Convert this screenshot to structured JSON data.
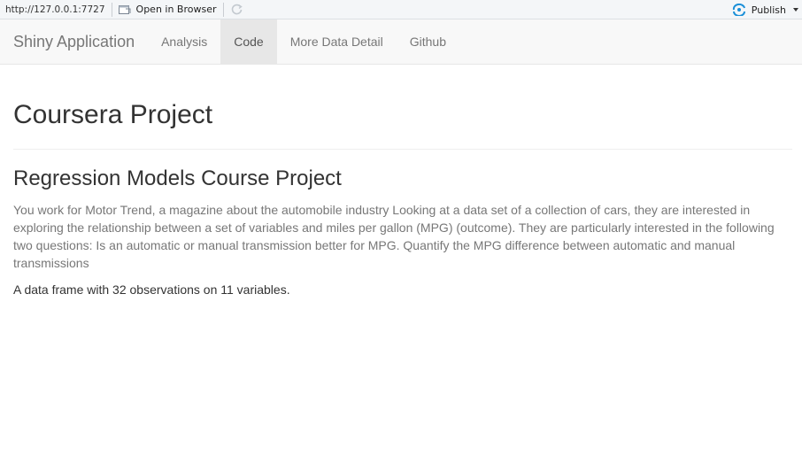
{
  "viewer": {
    "url": "http://127.0.0.1:7727",
    "open_browser_label": "Open in Browser",
    "publish_label": "Publish"
  },
  "navbar": {
    "brand": "Shiny Application",
    "tabs": [
      {
        "label": "Analysis",
        "active": false
      },
      {
        "label": "Code",
        "active": true
      },
      {
        "label": "More Data Detail",
        "active": false
      },
      {
        "label": "Github",
        "active": false
      }
    ]
  },
  "main": {
    "title": "Coursera Project",
    "section_title": "Regression Models Course Project",
    "description": "You work for Motor Trend, a magazine about the automobile industry Looking at a data set of a collection of cars, they are interested in exploring the relationship between a set of variables and miles per gallon (MPG) (outcome). They are particularly interested in the following two questions: Is an automatic or manual transmission better for MPG. Quantify the MPG difference between automatic and manual transmissions",
    "data_summary": "A data frame with 32 observations on 11 variables."
  },
  "colors": {
    "navbar_bg": "#f8f8f8",
    "active_tab_bg": "#e7e7e7",
    "publish_icon": "#1a8fd8"
  },
  "icons": {
    "open_browser": "browser-window-icon",
    "refresh": "refresh-icon",
    "publish": "publish-icon"
  }
}
